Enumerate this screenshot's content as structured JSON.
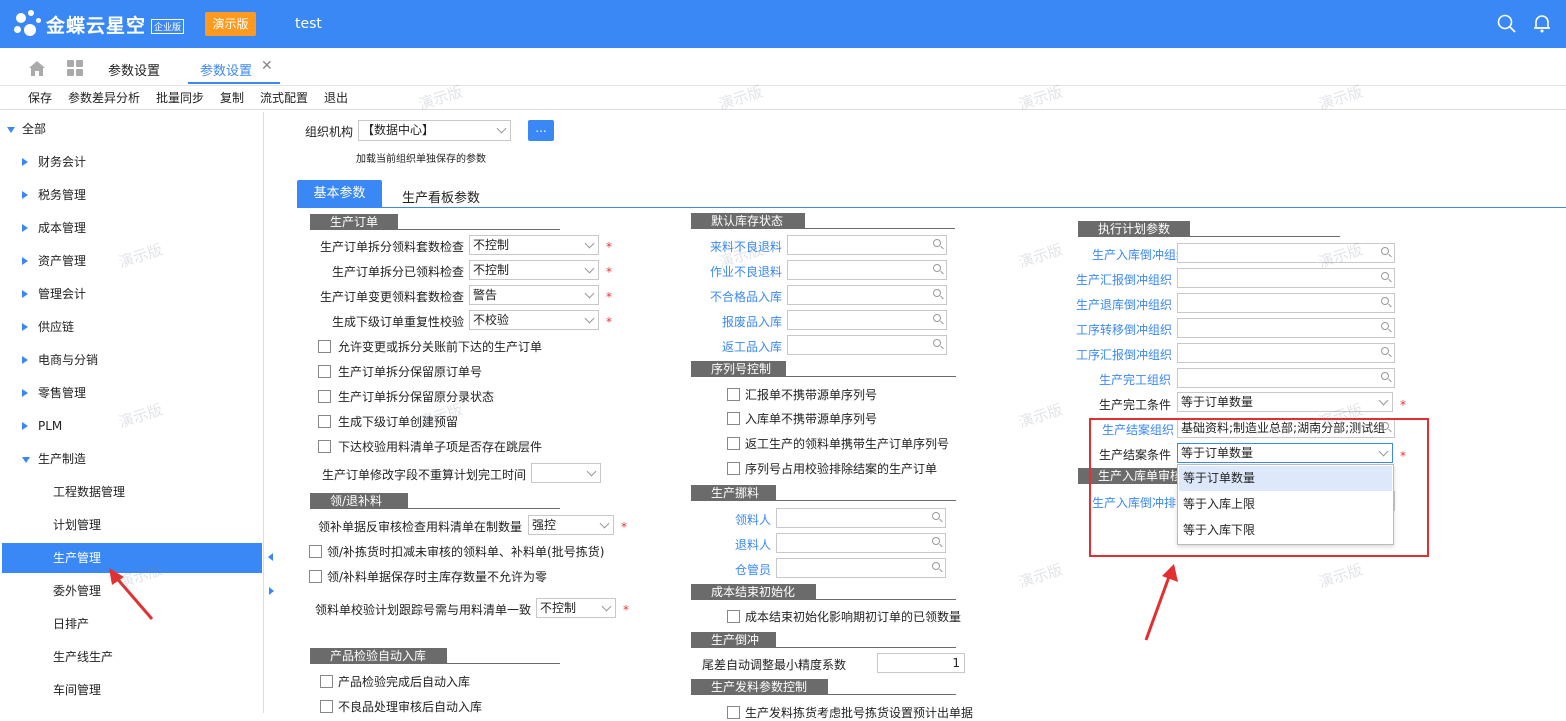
{
  "app": {
    "brand": "金蝶云星空",
    "edition": "企业版",
    "demo": "演示版",
    "tenant": "test"
  },
  "tabs": {
    "first": "参数设置",
    "second": "参数设置",
    "close": "✕"
  },
  "toolbar": [
    "保存",
    "参数差异分析",
    "批量同步",
    "复制",
    "流式配置",
    "退出"
  ],
  "sidebar": {
    "root": "全部",
    "items": [
      "财务会计",
      "税务管理",
      "成本管理",
      "资产管理",
      "管理会计",
      "供应链",
      "电商与分销",
      "零售管理",
      "PLM",
      "生产制造"
    ],
    "children": [
      "工程数据管理",
      "计划管理",
      "生产管理",
      "委外管理",
      "日排产",
      "生产线生产",
      "车间管理"
    ],
    "selected": "生产管理"
  },
  "org": {
    "label": "组织机构",
    "value": "【数据中心】",
    "hint": "加载当前组织单独保存的参数",
    "more": "..."
  },
  "subtabs": [
    "基本参数",
    "生产看板参数"
  ],
  "col1": {
    "sec_order": "生产订单",
    "rows": [
      {
        "label": "生产订单拆分领料套数检查",
        "value": "不控制"
      },
      {
        "label": "生产订单拆分已领料检查",
        "value": "不控制"
      },
      {
        "label": "生产订单变更领料套数检查",
        "value": "警告"
      },
      {
        "label": "生成下级订单重复性校验",
        "value": "不校验"
      }
    ],
    "checks": [
      "允许变更或拆分关账前下达的生产订单",
      "生产订单拆分保留原订单号",
      "生产订单拆分保留原分录状态",
      "生成下级订单创建预留",
      "下达校验用料清单子项是否存在跳层件"
    ],
    "time_label": "生产订单修改字段不重算计划完工时间",
    "sec_return": "领/退补料",
    "ret_label": "领补单据反审核检查用料清单在制数量",
    "ret_value": "强控",
    "ret_checks": [
      "领/补拣货时扣减未审核的领料单、补料单(批号拣货)",
      "领/补料单据保存时主库存数量不允许为零"
    ],
    "track_label": "领料单校验计划跟踪号需与用料清单一致",
    "track_value": "不控制",
    "sec_inspect": "产品检验自动入库",
    "inspect_checks": [
      "产品检验完成后自动入库",
      "不良品处理审核后自动入库"
    ]
  },
  "col2": {
    "sec_stock": "默认库存状态",
    "stock": [
      "来料不良退料",
      "作业不良退料",
      "不合格品入库",
      "报废品入库",
      "返工品入库"
    ],
    "sec_serial": "序列号控制",
    "serial": [
      "汇报单不携带源单序列号",
      "入库单不携带源单序列号",
      "返工生产的领料单携带生产订单序列号",
      "序列号占用校验排除结案的生产订单"
    ],
    "sec_pick": "生产挪料",
    "pick": [
      "领料人",
      "退料人",
      "仓管员"
    ],
    "sec_cost": "成本结束初始化",
    "cost_check": "成本结束初始化影响期初订单的已领数量",
    "sec_offset": "生产倒冲",
    "offset_label": "尾差自动调整最小精度系数",
    "offset_value": "1",
    "sec_issue": "生产发料参数控制",
    "issue_check": "生产发料拣货考虑批号拣货设置预计出单据"
  },
  "col3": {
    "sec_exec": "执行计划参数",
    "rows": [
      "生产入库倒冲组织",
      "生产汇报倒冲组织",
      "生产退库倒冲组织",
      "工序转移倒冲组织",
      "工序汇报倒冲组织",
      "生产完工组织"
    ],
    "finish_cond_label": "生产完工条件",
    "finish_cond_value": "等于订单数量",
    "close_org_label": "生产结案组织",
    "close_org_value": "基础资料;制造业总部;湖南分部;测试组",
    "close_cond_label": "生产结案条件",
    "close_cond_value": "等于订单数量",
    "sec_audit": "生产入库单审核",
    "audit_label": "生产入库倒冲排",
    "options": [
      "等于订单数量",
      "等于入库上限",
      "等于入库下限"
    ]
  },
  "watermark": "演示版"
}
